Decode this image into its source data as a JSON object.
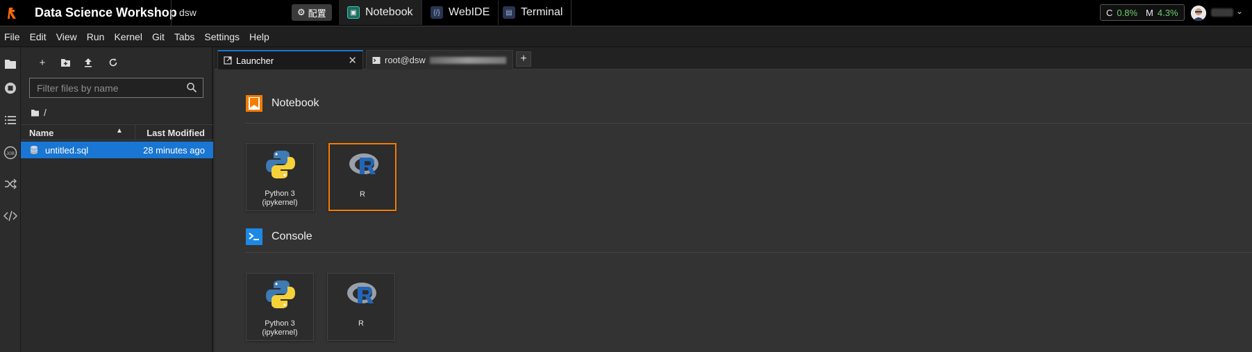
{
  "topbar": {
    "app_title": "Data Science Workshop",
    "workspace": "dsw",
    "config_label": "配置",
    "tabs": [
      {
        "label": "Notebook",
        "active": true
      },
      {
        "label": "WebIDE",
        "active": false
      },
      {
        "label": "Terminal",
        "active": false
      }
    ],
    "usage": {
      "cpu_label": "C",
      "cpu_value": "0.8%",
      "mem_label": "M",
      "mem_value": "4.3%"
    }
  },
  "menu": [
    "File",
    "Edit",
    "View",
    "Run",
    "Kernel",
    "Git",
    "Tabs",
    "Settings",
    "Help"
  ],
  "filebrowser": {
    "search_placeholder": "Filter files by name",
    "breadcrumb": "/",
    "columns": {
      "name": "Name",
      "modified": "Last Modified"
    },
    "files": [
      {
        "name": "untitled.sql",
        "modified": "28 minutes ago",
        "selected": true
      }
    ]
  },
  "doc_tabs": [
    {
      "label": "Launcher",
      "active": true
    },
    {
      "label": "root@dsw",
      "active": false
    }
  ],
  "launcher": {
    "sections": [
      {
        "title": "Notebook",
        "items": [
          {
            "label": "Python 3 (ipykernel)",
            "icon": "python-logo-icon",
            "selected": false
          },
          {
            "label": "R",
            "icon": "r-logo-icon",
            "selected": true
          }
        ]
      },
      {
        "title": "Console",
        "items": [
          {
            "label": "Python 3 (ipykernel)",
            "icon": "python-logo-icon",
            "selected": false
          },
          {
            "label": "R",
            "icon": "r-logo-icon",
            "selected": false
          }
        ]
      }
    ]
  },
  "colors": {
    "accent": "#1976d2",
    "notebook_section": "#f57c00",
    "console_section": "#1e88e5",
    "cpu_green": "#6fcf6f"
  }
}
